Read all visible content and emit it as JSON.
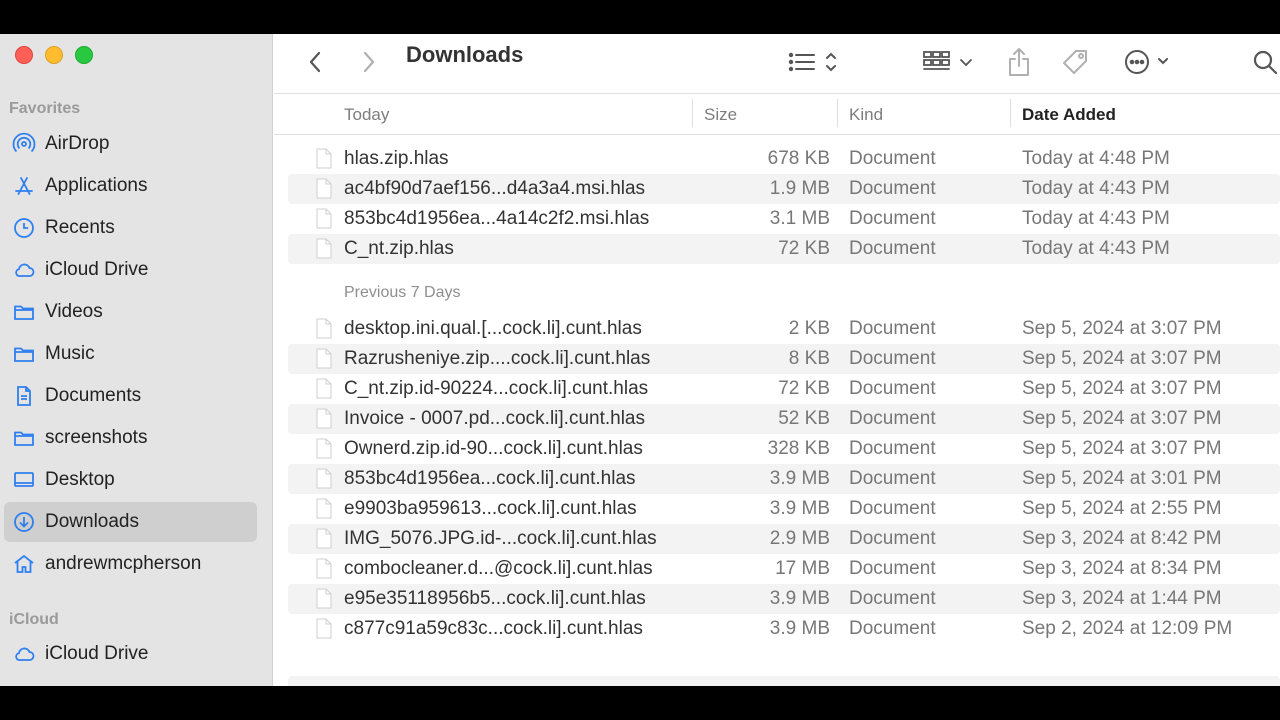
{
  "sidebar": {
    "favorites_header": "Favorites",
    "icloud_header": "iCloud",
    "items": [
      {
        "label": "AirDrop",
        "icon": "airdrop-icon"
      },
      {
        "label": "Applications",
        "icon": "applications-icon"
      },
      {
        "label": "Recents",
        "icon": "clock-icon"
      },
      {
        "label": "iCloud Drive",
        "icon": "cloud-icon"
      },
      {
        "label": "Videos",
        "icon": "folder-icon"
      },
      {
        "label": "Music",
        "icon": "folder-icon"
      },
      {
        "label": "Documents",
        "icon": "document-icon"
      },
      {
        "label": "screenshots",
        "icon": "folder-icon"
      },
      {
        "label": "Desktop",
        "icon": "desktop-icon"
      },
      {
        "label": "Downloads",
        "icon": "download-icon",
        "selected": true
      },
      {
        "label": "andrewmcpherson",
        "icon": "home-icon"
      }
    ],
    "icloud_items": [
      {
        "label": "iCloud Drive",
        "icon": "cloud-icon"
      }
    ]
  },
  "toolbar": {
    "title": "Downloads"
  },
  "columns": {
    "name": "Today",
    "size": "Size",
    "kind": "Kind",
    "date": "Date Added"
  },
  "groups": {
    "today_rows": [
      {
        "name": "hlas.zip.hlas",
        "size": "678 KB",
        "kind": "Document",
        "date": "Today at 4:48 PM"
      },
      {
        "name": "ac4bf90d7aef156...d4a3a4.msi.hlas",
        "size": "1.9 MB",
        "kind": "Document",
        "date": "Today at 4:43 PM"
      },
      {
        "name": "853bc4d1956ea...4a14c2f2.msi.hlas",
        "size": "3.1 MB",
        "kind": "Document",
        "date": "Today at 4:43 PM"
      },
      {
        "name": "C_nt.zip.hlas",
        "size": "72 KB",
        "kind": "Document",
        "date": "Today at 4:43 PM"
      }
    ],
    "previous_label": "Previous 7 Days",
    "previous_rows": [
      {
        "name": "desktop.ini.qual.[...cock.li].cunt.hlas",
        "size": "2 KB",
        "kind": "Document",
        "date": "Sep 5, 2024 at 3:07 PM"
      },
      {
        "name": "Razrusheniye.zip....cock.li].cunt.hlas",
        "size": "8 KB",
        "kind": "Document",
        "date": "Sep 5, 2024 at 3:07 PM"
      },
      {
        "name": "C_nt.zip.id-90224...cock.li].cunt.hlas",
        "size": "72 KB",
        "kind": "Document",
        "date": "Sep 5, 2024 at 3:07 PM"
      },
      {
        "name": "Invoice - 0007.pd...cock.li].cunt.hlas",
        "size": "52 KB",
        "kind": "Document",
        "date": "Sep 5, 2024 at 3:07 PM"
      },
      {
        "name": "Ownerd.zip.id-90...cock.li].cunt.hlas",
        "size": "328 KB",
        "kind": "Document",
        "date": "Sep 5, 2024 at 3:07 PM"
      },
      {
        "name": "853bc4d1956ea...cock.li].cunt.hlas",
        "size": "3.9 MB",
        "kind": "Document",
        "date": "Sep 5, 2024 at 3:01 PM"
      },
      {
        "name": "e9903ba959613...cock.li].cunt.hlas",
        "size": "3.9 MB",
        "kind": "Document",
        "date": "Sep 5, 2024 at 2:55 PM"
      },
      {
        "name": "IMG_5076.JPG.id-...cock.li].cunt.hlas",
        "size": "2.9 MB",
        "kind": "Document",
        "date": "Sep 3, 2024 at 8:42 PM"
      },
      {
        "name": "combocleaner.d...@cock.li].cunt.hlas",
        "size": "17 MB",
        "kind": "Document",
        "date": "Sep 3, 2024 at 8:34 PM"
      },
      {
        "name": "e95e35118956b5...cock.li].cunt.hlas",
        "size": "3.9 MB",
        "kind": "Document",
        "date": "Sep 3, 2024 at 1:44 PM"
      },
      {
        "name": "c877c91a59c83c...cock.li].cunt.hlas",
        "size": "3.9 MB",
        "kind": "Document",
        "date": "Sep 2, 2024 at 12:09 PM"
      }
    ]
  }
}
